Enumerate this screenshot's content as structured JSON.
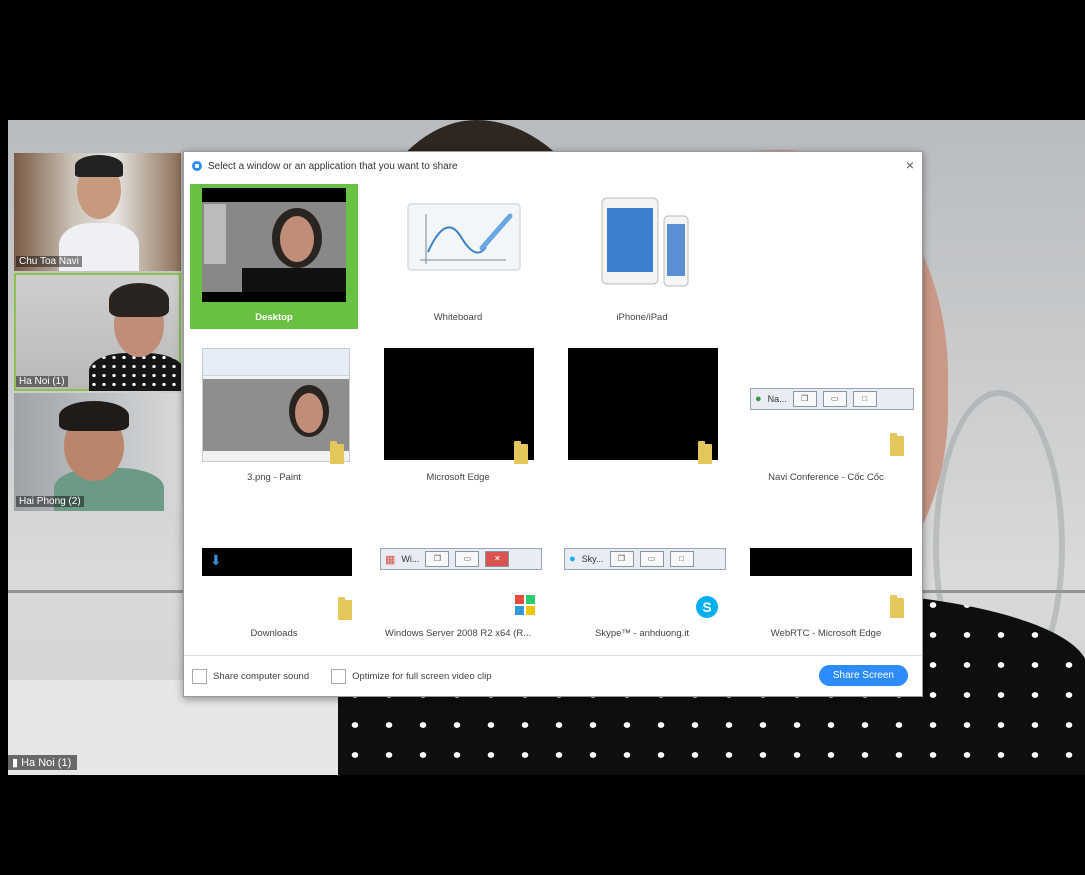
{
  "meeting": {
    "speaker_label": "Ha Noi (1)",
    "participants": [
      {
        "name": "Chu Toa Navi"
      },
      {
        "name": "Ha Noi (1)"
      },
      {
        "name": "Hai Phong (2)"
      }
    ]
  },
  "dialog": {
    "title": "Select a window or an application that you want to share",
    "close_symbol": "×",
    "items": [
      {
        "label": "Desktop",
        "selected": true,
        "icon": "desktop-preview"
      },
      {
        "label": "Whiteboard",
        "selected": false,
        "icon": "whiteboard-icon"
      },
      {
        "label": "iPhone/iPad",
        "selected": false,
        "icon": "iphone-ipad-icon"
      },
      {
        "label": "3.png - Paint",
        "selected": false,
        "icon": "folder-icon"
      },
      {
        "label": "Microsoft Edge",
        "selected": false,
        "icon": "folder-icon"
      },
      {
        "label": "Navi Conference - Cốc Cốc",
        "selected": false,
        "icon": "folder-icon",
        "mini_title": "Na..."
      },
      {
        "label": "Downloads",
        "selected": false,
        "icon": "downloads-folder-icon"
      },
      {
        "label": "Windows Server 2008 R2 x64 (R...",
        "selected": false,
        "icon": "windows-flag-icon",
        "mini_title": "Wi..."
      },
      {
        "label": "Skype™ - anhduong.it",
        "selected": false,
        "icon": "skype-icon",
        "mini_title": "Sky..."
      },
      {
        "label": "WebRTC - Microsoft Edge",
        "selected": false,
        "icon": "folder-icon"
      }
    ],
    "footer": {
      "share_sound_label": "Share computer sound",
      "optimize_label": "Optimize for full screen video clip",
      "share_button_label": "Share Screen"
    }
  },
  "colors": {
    "selected_tile": "#6ac043",
    "share_button": "#2d8cff"
  }
}
